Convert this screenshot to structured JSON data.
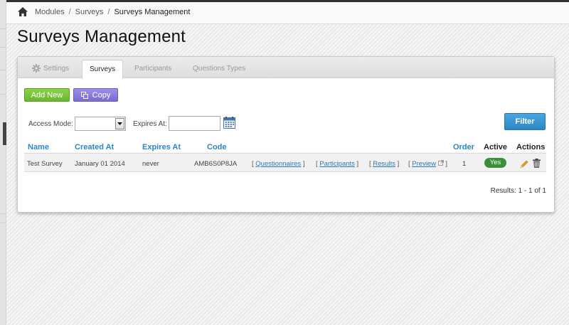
{
  "breadcrumb": {
    "items": [
      "Modules",
      "Surveys",
      "Surveys Management"
    ],
    "separator": "/"
  },
  "page": {
    "title": "Surveys Management"
  },
  "tabs": [
    {
      "label": "Settings",
      "icon": "gear-icon",
      "active": false
    },
    {
      "label": "Surveys",
      "active": true
    },
    {
      "label": "Participants",
      "active": false
    },
    {
      "label": "Questions Types",
      "active": false
    }
  ],
  "toolbar": {
    "add_label": "Add New",
    "copy_label": "Copy"
  },
  "filters": {
    "access_mode_label": "Access Mode:",
    "access_mode_value": "",
    "expires_at_label": "Expires At:",
    "expires_at_value": "",
    "filter_label": "Filter"
  },
  "table": {
    "columns": [
      "Name",
      "Created At",
      "Expires At",
      "Code",
      "Order",
      "Active",
      "Actions"
    ],
    "rows": [
      {
        "name": "Test Survey",
        "created_at": "January 01 2014",
        "expires_at": "never",
        "code": "AMB6S0P8JA",
        "links": [
          "Questionnaires",
          "Participants",
          "Results",
          "Preview"
        ],
        "order": "1",
        "active": "Yes"
      }
    ]
  },
  "pagination": {
    "results_text": "Results: 1 - 1 of 1"
  },
  "colors": {
    "accent_link": "#2a86c4",
    "add_button": "#7cc43d",
    "copy_button": "#8a7de0",
    "filter_button": "#3a97d4",
    "active_badge": "#3a8f3a"
  }
}
